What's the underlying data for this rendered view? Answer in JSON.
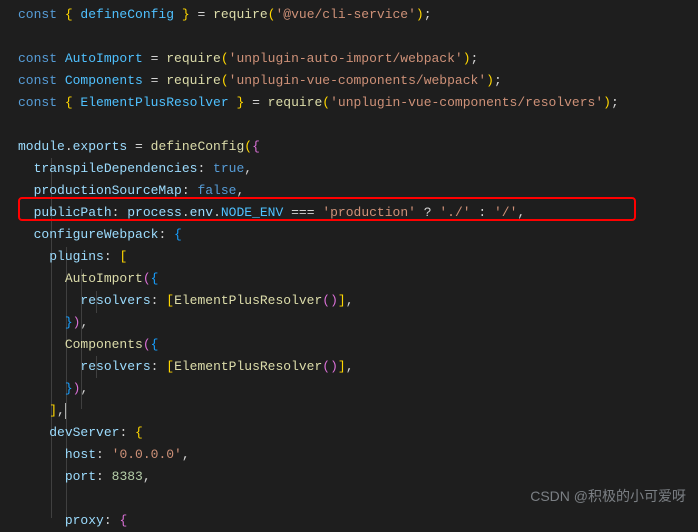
{
  "code": {
    "l1_const": "const",
    "l1_brace_open": " { ",
    "l1_defineConfig": "defineConfig",
    "l1_brace_close": " } ",
    "l1_eq": "= ",
    "l1_require": "require",
    "l1_paren_open": "(",
    "l1_str": "'@vue/cli-service'",
    "l1_paren_close": ")",
    "l1_semi": ";",
    "l3_const": "const",
    "l3_var": " AutoImport ",
    "l3_eq": "= ",
    "l3_require": "require",
    "l3_str": "'unplugin-auto-import/webpack'",
    "l4_var": " Components ",
    "l4_str": "'unplugin-vue-components/webpack'",
    "l5_var": "ElementPlusResolver",
    "l5_str": "'unplugin-vue-components/resolvers'",
    "l7_module": "module",
    "l7_dot": ".",
    "l7_exports": "exports",
    "l7_eq": " = ",
    "l7_defineConfig": "defineConfig",
    "l8_key": "transpileDependencies",
    "l8_val": "true",
    "l9_key": "productionSourceMap",
    "l9_val": "false",
    "l10_key": "publicPath",
    "l10_process": "process",
    "l10_env": "env",
    "l10_nodeenv": "NODE_ENV",
    "l10_eqeqeq": " === ",
    "l10_prod": "'production'",
    "l10_q": " ? ",
    "l10_dotslash": "'./'",
    "l10_colon": " : ",
    "l10_slash": "'/'",
    "l11_key": "configureWebpack",
    "l12_key": "plugins",
    "l13_auto": "AutoImport",
    "l14_key": "resolvers",
    "l14_resolver": "ElementPlusResolver",
    "l16_comp": "Components",
    "l20_key": "devServer",
    "l21_key": "host",
    "l21_val": "'0.0.0.0'",
    "l22_key": "port",
    "l22_val": "8383",
    "l24_key": "proxy"
  },
  "watermark": "CSDN @积极的小可爱呀"
}
